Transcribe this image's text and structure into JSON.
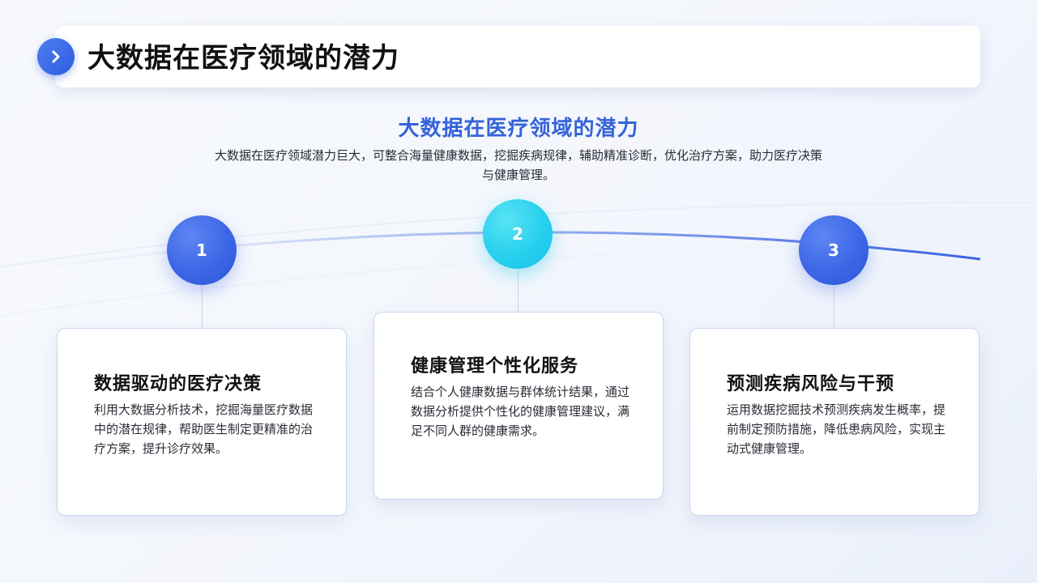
{
  "header": {
    "title": "大数据在医疗领域的潜力",
    "badge_icon": "chevron-right-icon"
  },
  "intro": {
    "title": "大数据在医疗领域的潜力",
    "description": "大数据在医疗领域潜力巨大，可整合海量健康数据，挖掘疾病规律，辅助精准诊断，优化治疗方案，助力医疗决策与健康管理。"
  },
  "steps": [
    {
      "number": "1",
      "title": "数据驱动的医疗决策",
      "body": "利用大数据分析技术，挖掘海量医疗数据中的潜在规律，帮助医生制定更精准的治疗方案，提升诊疗效果。"
    },
    {
      "number": "2",
      "title": "健康管理个性化服务",
      "body": "结合个人健康数据与群体统计结果，通过数据分析提供个性化的健康管理建议，满足不同人群的健康需求。"
    },
    {
      "number": "3",
      "title": "预测疾病风险与干预",
      "body": "运用数据挖掘技术预测疾病发生概率，提前制定预防措施，降低患病风险，实现主动式健康管理。"
    }
  ],
  "colors": {
    "accent_blue": "#3b66e6",
    "accent_cyan": "#27d0ee",
    "title_blue": "#3563d9"
  }
}
